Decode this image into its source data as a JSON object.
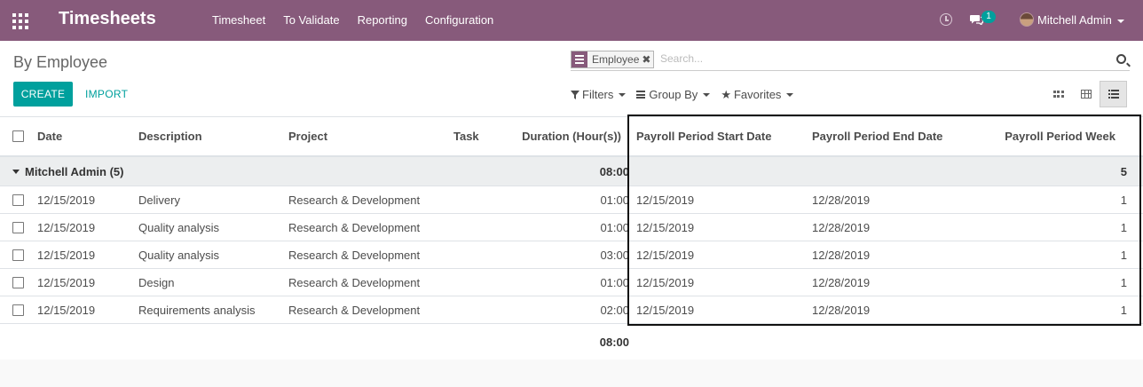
{
  "app": {
    "brand": "Timesheets",
    "menu": [
      "Timesheet",
      "To Validate",
      "Reporting",
      "Configuration"
    ],
    "chat_count": "1",
    "user": "Mitchell Admin"
  },
  "control": {
    "breadcrumb": "By Employee",
    "facet": "Employee",
    "facet_remove": "✖",
    "search_placeholder": "Search...",
    "create_label": "CREATE",
    "import_label": "IMPORT",
    "filters_label": "Filters",
    "groupby_label": "Group By",
    "favorites_label": "Favorites"
  },
  "table": {
    "columns": [
      "Date",
      "Description",
      "Project",
      "Task",
      "Duration (Hour(s))",
      "Payroll Period Start Date",
      "Payroll Period End Date",
      "Payroll Period Week"
    ],
    "group": {
      "label": "Mitchell Admin (5)",
      "duration": "08:00",
      "week": "5"
    },
    "rows": [
      {
        "date": "12/15/2019",
        "description": "Delivery",
        "project": "Research & Development",
        "task": "",
        "duration": "01:00",
        "start": "12/15/2019",
        "end": "12/28/2019",
        "week": "1"
      },
      {
        "date": "12/15/2019",
        "description": "Quality analysis",
        "project": "Research & Development",
        "task": "",
        "duration": "01:00",
        "start": "12/15/2019",
        "end": "12/28/2019",
        "week": "1"
      },
      {
        "date": "12/15/2019",
        "description": "Quality analysis",
        "project": "Research & Development",
        "task": "",
        "duration": "03:00",
        "start": "12/15/2019",
        "end": "12/28/2019",
        "week": "1"
      },
      {
        "date": "12/15/2019",
        "description": "Design",
        "project": "Research & Development",
        "task": "",
        "duration": "01:00",
        "start": "12/15/2019",
        "end": "12/28/2019",
        "week": "1"
      },
      {
        "date": "12/15/2019",
        "description": "Requirements analysis",
        "project": "Research & Development",
        "task": "",
        "duration": "02:00",
        "start": "12/15/2019",
        "end": "12/28/2019",
        "week": "1"
      }
    ],
    "total_duration": "08:00"
  },
  "colors": {
    "brand": "#875a7b",
    "accent": "#00a09d"
  },
  "icons": [
    "apps-icon",
    "clock-icon",
    "chat-icon",
    "avatar",
    "search-icon",
    "filter-icon",
    "group-by-icon",
    "star-icon",
    "kanban-view-icon",
    "grid-view-icon",
    "list-view-icon",
    "checkbox",
    "collapse-caret-icon"
  ]
}
